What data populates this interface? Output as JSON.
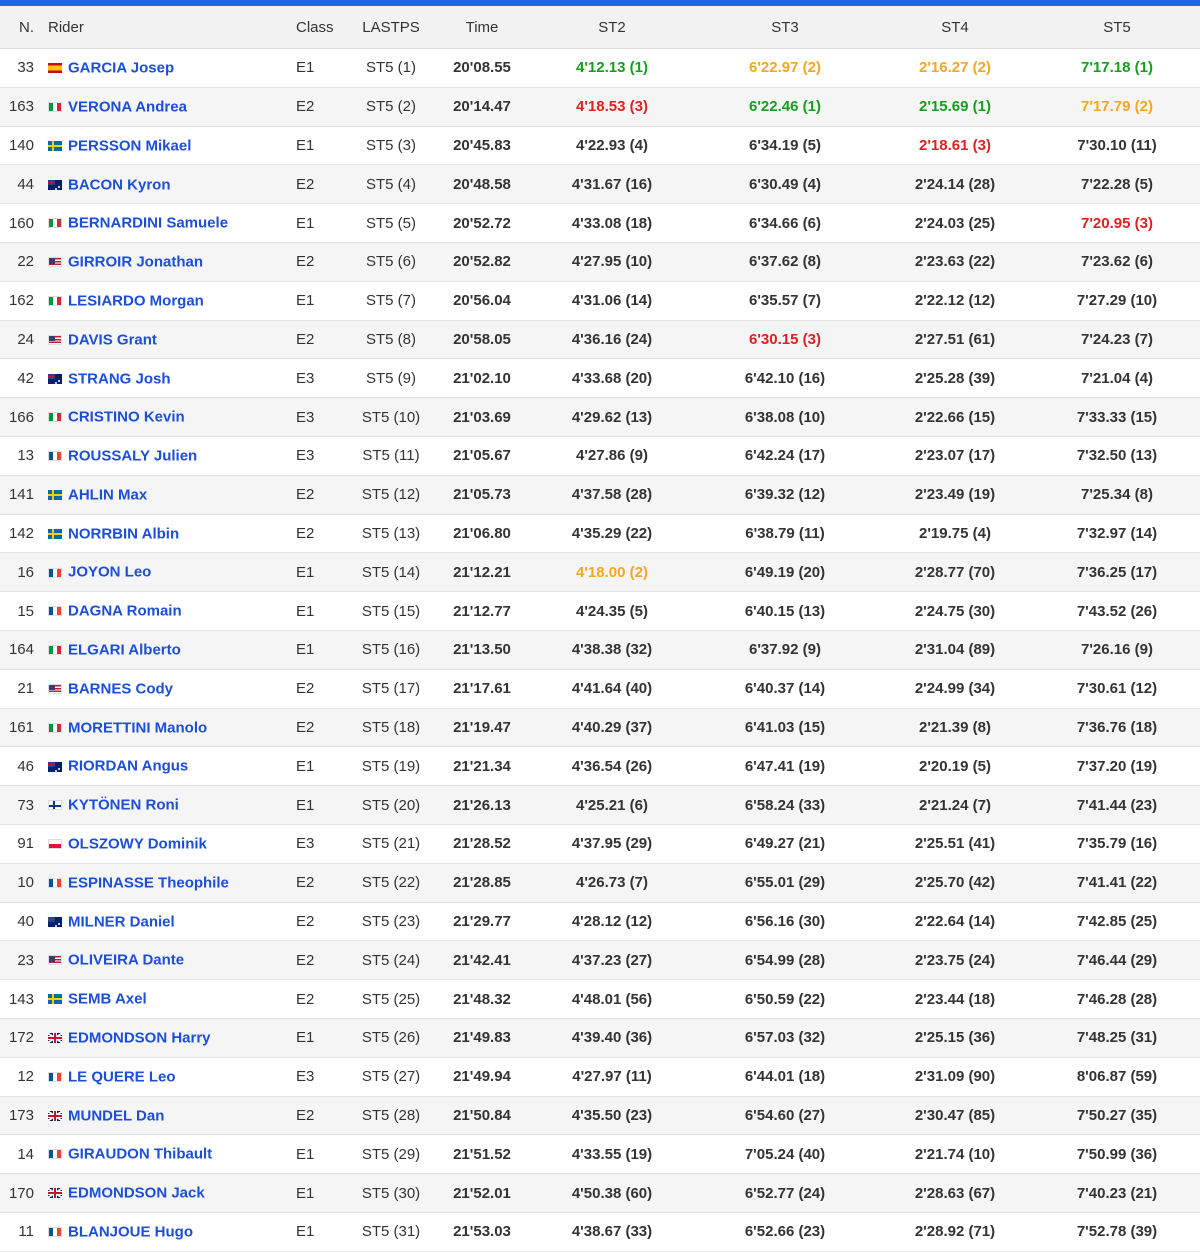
{
  "table": {
    "headers": [
      "N.",
      "Rider",
      "Class",
      "LASTPS",
      "Time",
      "ST2",
      "ST3",
      "ST4",
      "ST5"
    ],
    "rows": [
      {
        "num": "33",
        "flag": "es",
        "rider": "GARCIA Josep",
        "class": "E1",
        "lastps": "ST5 (1)",
        "time": "20'08.55",
        "st2": "4'12.13 (1)",
        "st3": "6'22.97 (2)",
        "st4": "2'16.27 (2)",
        "st5": "7'17.18 (1)"
      },
      {
        "num": "163",
        "flag": "it",
        "rider": "VERONA Andrea",
        "class": "E2",
        "lastps": "ST5 (2)",
        "time": "20'14.47",
        "st2": "4'18.53 (3)",
        "st3": "6'22.46 (1)",
        "st4": "2'15.69 (1)",
        "st5": "7'17.79 (2)"
      },
      {
        "num": "140",
        "flag": "se",
        "rider": "PERSSON Mikael",
        "class": "E1",
        "lastps": "ST5 (3)",
        "time": "20'45.83",
        "st2": "4'22.93 (4)",
        "st3": "6'34.19 (5)",
        "st4": "2'18.61 (3)",
        "st5": "7'30.10 (11)"
      },
      {
        "num": "44",
        "flag": "au",
        "rider": "BACON Kyron",
        "class": "E2",
        "lastps": "ST5 (4)",
        "time": "20'48.58",
        "st2": "4'31.67 (16)",
        "st3": "6'30.49 (4)",
        "st4": "2'24.14 (28)",
        "st5": "7'22.28 (5)"
      },
      {
        "num": "160",
        "flag": "it",
        "rider": "BERNARDINI Samuele",
        "class": "E1",
        "lastps": "ST5 (5)",
        "time": "20'52.72",
        "st2": "4'33.08 (18)",
        "st3": "6'34.66 (6)",
        "st4": "2'24.03 (25)",
        "st5": "7'20.95 (3)"
      },
      {
        "num": "22",
        "flag": "us",
        "rider": "GIRROIR Jonathan",
        "class": "E2",
        "lastps": "ST5 (6)",
        "time": "20'52.82",
        "st2": "4'27.95 (10)",
        "st3": "6'37.62 (8)",
        "st4": "2'23.63 (22)",
        "st5": "7'23.62 (6)"
      },
      {
        "num": "162",
        "flag": "it",
        "rider": "LESIARDO Morgan",
        "class": "E1",
        "lastps": "ST5 (7)",
        "time": "20'56.04",
        "st2": "4'31.06 (14)",
        "st3": "6'35.57 (7)",
        "st4": "2'22.12 (12)",
        "st5": "7'27.29 (10)"
      },
      {
        "num": "24",
        "flag": "us",
        "rider": "DAVIS Grant",
        "class": "E2",
        "lastps": "ST5 (8)",
        "time": "20'58.05",
        "st2": "4'36.16 (24)",
        "st3": "6'30.15 (3)",
        "st4": "2'27.51 (61)",
        "st5": "7'24.23 (7)"
      },
      {
        "num": "42",
        "flag": "au",
        "rider": "STRANG Josh",
        "class": "E3",
        "lastps": "ST5 (9)",
        "time": "21'02.10",
        "st2": "4'33.68 (20)",
        "st3": "6'42.10 (16)",
        "st4": "2'25.28 (39)",
        "st5": "7'21.04 (4)"
      },
      {
        "num": "166",
        "flag": "it",
        "rider": "CRISTINO Kevin",
        "class": "E3",
        "lastps": "ST5 (10)",
        "time": "21'03.69",
        "st2": "4'29.62 (13)",
        "st3": "6'38.08 (10)",
        "st4": "2'22.66 (15)",
        "st5": "7'33.33 (15)"
      },
      {
        "num": "13",
        "flag": "fr",
        "rider": "ROUSSALY Julien",
        "class": "E3",
        "lastps": "ST5 (11)",
        "time": "21'05.67",
        "st2": "4'27.86 (9)",
        "st3": "6'42.24 (17)",
        "st4": "2'23.07 (17)",
        "st5": "7'32.50 (13)"
      },
      {
        "num": "141",
        "flag": "se",
        "rider": "AHLIN Max",
        "class": "E2",
        "lastps": "ST5 (12)",
        "time": "21'05.73",
        "st2": "4'37.58 (28)",
        "st3": "6'39.32 (12)",
        "st4": "2'23.49 (19)",
        "st5": "7'25.34 (8)"
      },
      {
        "num": "142",
        "flag": "se",
        "rider": "NORRBIN Albin",
        "class": "E2",
        "lastps": "ST5 (13)",
        "time": "21'06.80",
        "st2": "4'35.29 (22)",
        "st3": "6'38.79 (11)",
        "st4": "2'19.75 (4)",
        "st5": "7'32.97 (14)"
      },
      {
        "num": "16",
        "flag": "fr",
        "rider": "JOYON Leo",
        "class": "E1",
        "lastps": "ST5 (14)",
        "time": "21'12.21",
        "st2": "4'18.00 (2)",
        "st3": "6'49.19 (20)",
        "st4": "2'28.77 (70)",
        "st5": "7'36.25 (17)"
      },
      {
        "num": "15",
        "flag": "fr",
        "rider": "DAGNA Romain",
        "class": "E1",
        "lastps": "ST5 (15)",
        "time": "21'12.77",
        "st2": "4'24.35 (5)",
        "st3": "6'40.15 (13)",
        "st4": "2'24.75 (30)",
        "st5": "7'43.52 (26)"
      },
      {
        "num": "164",
        "flag": "it",
        "rider": "ELGARI Alberto",
        "class": "E1",
        "lastps": "ST5 (16)",
        "time": "21'13.50",
        "st2": "4'38.38 (32)",
        "st3": "6'37.92 (9)",
        "st4": "2'31.04 (89)",
        "st5": "7'26.16 (9)"
      },
      {
        "num": "21",
        "flag": "us",
        "rider": "BARNES Cody",
        "class": "E2",
        "lastps": "ST5 (17)",
        "time": "21'17.61",
        "st2": "4'41.64 (40)",
        "st3": "6'40.37 (14)",
        "st4": "2'24.99 (34)",
        "st5": "7'30.61 (12)"
      },
      {
        "num": "161",
        "flag": "it",
        "rider": "MORETTINI Manolo",
        "class": "E2",
        "lastps": "ST5 (18)",
        "time": "21'19.47",
        "st2": "4'40.29 (37)",
        "st3": "6'41.03 (15)",
        "st4": "2'21.39 (8)",
        "st5": "7'36.76 (18)"
      },
      {
        "num": "46",
        "flag": "au",
        "rider": "RIORDAN Angus",
        "class": "E1",
        "lastps": "ST5 (19)",
        "time": "21'21.34",
        "st2": "4'36.54 (26)",
        "st3": "6'47.41 (19)",
        "st4": "2'20.19 (5)",
        "st5": "7'37.20 (19)"
      },
      {
        "num": "73",
        "flag": "fi",
        "rider": "KYTÖNEN Roni",
        "class": "E1",
        "lastps": "ST5 (20)",
        "time": "21'26.13",
        "st2": "4'25.21 (6)",
        "st3": "6'58.24 (33)",
        "st4": "2'21.24 (7)",
        "st5": "7'41.44 (23)"
      },
      {
        "num": "91",
        "flag": "pl",
        "rider": "OLSZOWY Dominik",
        "class": "E3",
        "lastps": "ST5 (21)",
        "time": "21'28.52",
        "st2": "4'37.95 (29)",
        "st3": "6'49.27 (21)",
        "st4": "2'25.51 (41)",
        "st5": "7'35.79 (16)"
      },
      {
        "num": "10",
        "flag": "fr",
        "rider": "ESPINASSE Theophile",
        "class": "E2",
        "lastps": "ST5 (22)",
        "time": "21'28.85",
        "st2": "4'26.73 (7)",
        "st3": "6'55.01 (29)",
        "st4": "2'25.70 (42)",
        "st5": "7'41.41 (22)"
      },
      {
        "num": "40",
        "flag": "au",
        "rider": "MILNER Daniel",
        "class": "E2",
        "lastps": "ST5 (23)",
        "time": "21'29.77",
        "st2": "4'28.12 (12)",
        "st3": "6'56.16 (30)",
        "st4": "2'22.64 (14)",
        "st5": "7'42.85 (25)"
      },
      {
        "num": "23",
        "flag": "us",
        "rider": "OLIVEIRA Dante",
        "class": "E2",
        "lastps": "ST5 (24)",
        "time": "21'42.41",
        "st2": "4'37.23 (27)",
        "st3": "6'54.99 (28)",
        "st4": "2'23.75 (24)",
        "st5": "7'46.44 (29)"
      },
      {
        "num": "143",
        "flag": "se",
        "rider": "SEMB Axel",
        "class": "E2",
        "lastps": "ST5 (25)",
        "time": "21'48.32",
        "st2": "4'48.01 (56)",
        "st3": "6'50.59 (22)",
        "st4": "2'23.44 (18)",
        "st5": "7'46.28 (28)"
      },
      {
        "num": "172",
        "flag": "gb",
        "rider": "EDMONDSON Harry",
        "class": "E1",
        "lastps": "ST5 (26)",
        "time": "21'49.83",
        "st2": "4'39.40 (36)",
        "st3": "6'57.03 (32)",
        "st4": "2'25.15 (36)",
        "st5": "7'48.25 (31)"
      },
      {
        "num": "12",
        "flag": "fr",
        "rider": "LE QUERE Leo",
        "class": "E3",
        "lastps": "ST5 (27)",
        "time": "21'49.94",
        "st2": "4'27.97 (11)",
        "st3": "6'44.01 (18)",
        "st4": "2'31.09 (90)",
        "st5": "8'06.87 (59)"
      },
      {
        "num": "173",
        "flag": "gb",
        "rider": "MUNDEL Dan",
        "class": "E2",
        "lastps": "ST5 (28)",
        "time": "21'50.84",
        "st2": "4'35.50 (23)",
        "st3": "6'54.60 (27)",
        "st4": "2'30.47 (85)",
        "st5": "7'50.27 (35)"
      },
      {
        "num": "14",
        "flag": "fr",
        "rider": "GIRAUDON Thibault",
        "class": "E1",
        "lastps": "ST5 (29)",
        "time": "21'51.52",
        "st2": "4'33.55 (19)",
        "st3": "7'05.24 (40)",
        "st4": "2'21.74 (10)",
        "st5": "7'50.99 (36)"
      },
      {
        "num": "170",
        "flag": "gb",
        "rider": "EDMONDSON Jack",
        "class": "E1",
        "lastps": "ST5 (30)",
        "time": "21'52.01",
        "st2": "4'50.38 (60)",
        "st3": "6'52.77 (24)",
        "st4": "2'28.63 (67)",
        "st5": "7'40.23 (21)"
      },
      {
        "num": "11",
        "flag": "fr",
        "rider": "BLANJOUE Hugo",
        "class": "E1",
        "lastps": "ST5 (31)",
        "time": "21'53.03",
        "st2": "4'38.67 (33)",
        "st3": "6'52.66 (23)",
        "st4": "2'28.92 (71)",
        "st5": "7'52.78 (39)"
      }
    ]
  },
  "rank_colors": {
    "1": "#169e1f",
    "2": "#f5a623",
    "3": "#e02020"
  },
  "accent_color": "#2563eb"
}
